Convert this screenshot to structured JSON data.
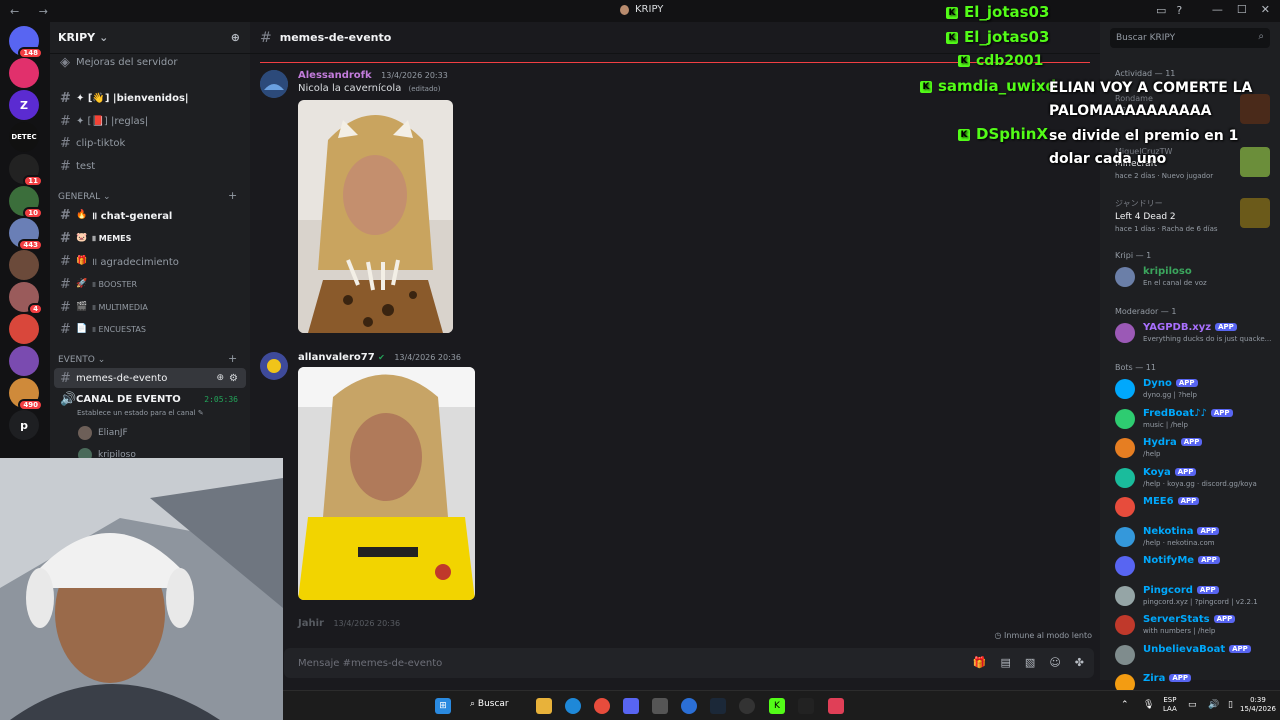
{
  "window": {
    "title": "KRIPY",
    "nav": "← →",
    "controls": [
      "—",
      "☐",
      "✕"
    ]
  },
  "server": {
    "name": "KRIPY",
    "boost_label": "Mejoras del servidor"
  },
  "rail": {
    "servers": [
      {
        "label": "",
        "color": "#5865f2",
        "badge": "148"
      },
      {
        "label": "",
        "color": "#e1306c",
        "badge": ""
      },
      {
        "label": "Z",
        "color": "#5b2bd1",
        "badge": ""
      },
      {
        "label": "DETEC",
        "color": "#111",
        "badge": ""
      },
      {
        "label": "",
        "color": "#222",
        "badge": "11"
      },
      {
        "label": "",
        "color": "#3b6e3b",
        "badge": "10"
      },
      {
        "label": "",
        "color": "#6a7fb6",
        "badge": "443"
      },
      {
        "label": "",
        "color": "#6b4a3a",
        "badge": ""
      },
      {
        "label": "",
        "color": "#9a5b5b",
        "badge": "4"
      },
      {
        "label": "",
        "color": "#d9473b",
        "badge": ""
      },
      {
        "label": "",
        "color": "#7a4bb0",
        "badge": ""
      },
      {
        "label": "",
        "color": "#cf8a3a",
        "badge": "490"
      },
      {
        "label": "p",
        "color": "#1e1f22",
        "badge": ""
      }
    ]
  },
  "channels": {
    "top": [
      {
        "name": "✦ [👋] |bienvenidos|",
        "bold": true
      },
      {
        "name": "✦ [📕] |reglas|",
        "bold": false
      },
      {
        "name": "clip-tiktok",
        "bold": false
      },
      {
        "name": "test",
        "bold": false
      }
    ],
    "general_label": "GENERAL",
    "general": [
      {
        "emoji": "🔥",
        "name": "॥ chat-general",
        "bold": true
      },
      {
        "emoji": "🐷",
        "name": "॥ MEMES",
        "bold": true
      },
      {
        "emoji": "🎁",
        "name": "॥ agradecimiento",
        "bold": false
      },
      {
        "emoji": "🚀",
        "name": "॥ BOOSTER",
        "bold": false
      },
      {
        "emoji": "🎬",
        "name": "॥ MULTIMEDIA",
        "bold": false
      },
      {
        "emoji": "📄",
        "name": "॥ ENCUESTAS",
        "bold": false
      }
    ],
    "evento_label": "EVENTO",
    "active": "memes-de-evento",
    "voice": {
      "name": "CANAL DE EVENTO",
      "timer": "2:05:36",
      "status": "Establece un estado para el canal"
    },
    "voice_users": [
      "ElianJF",
      "kripiloso"
    ]
  },
  "chat": {
    "channel": "memes-de-evento",
    "messages": [
      {
        "user": "Alessandrofk",
        "color": "#c27cdb",
        "time": "13/4/2026 20:33",
        "text": "Nicola la cavernícola",
        "edited": "(editado)"
      },
      {
        "user": "allanvalero77",
        "color": "#f2f3f5",
        "time": "13/4/2026 20:36",
        "text": "",
        "edited": ""
      },
      {
        "user": "Jahir",
        "color": "#949ba4",
        "time": "13/4/2026 20:36",
        "text": "",
        "edited": ""
      }
    ],
    "slowmode": "Inmune al modo lento",
    "placeholder": "Mensaje #memes-de-evento"
  },
  "members": {
    "search": "Buscar KRIPY",
    "activity_label": "Actividad — 11",
    "activities": [
      {
        "user": "Rondame",
        "game": "",
        "status": "2:22"
      },
      {
        "user": "MiguelCruzTW",
        "game": "Minecraft",
        "status": "hace 2 días · Nuevo jugador"
      },
      {
        "user": "ジャンドリー",
        "game": "Left 4 Dead 2",
        "status": "hace 1 días · Racha de 6 días"
      }
    ],
    "groups": [
      {
        "label": "Kripi — 1",
        "items": [
          {
            "name": "kripiloso",
            "sub": "En el canal de voz",
            "color": "#3ba55d",
            "app": false
          }
        ]
      },
      {
        "label": "Moderador — 1",
        "items": [
          {
            "name": "YAGPDB.xyz",
            "sub": "Everything ducks do is just quacke...",
            "color": "#a970ff",
            "app": true
          }
        ]
      },
      {
        "label": "Bots — 11",
        "items": [
          {
            "name": "Dyno",
            "sub": "dyno.gg | ?help",
            "color": "#00a8fc",
            "app": true
          },
          {
            "name": "FredBoat♪♪",
            "sub": "music | /help",
            "color": "#00a8fc",
            "app": true
          },
          {
            "name": "Hydra",
            "sub": "/help",
            "color": "#00a8fc",
            "app": true
          },
          {
            "name": "Koya",
            "sub": "/help · koya.gg · discord.gg/koya",
            "color": "#00a8fc",
            "app": true
          },
          {
            "name": "MEE6",
            "sub": "",
            "color": "#00a8fc",
            "app": true
          },
          {
            "name": "Nekotina",
            "sub": "/help · nekotina.com",
            "color": "#00a8fc",
            "app": true
          },
          {
            "name": "NotifyMe",
            "sub": "",
            "color": "#00a8fc",
            "app": true
          },
          {
            "name": "Pingcord",
            "sub": "pingcord.xyz | ?pingcord | v2.2.1",
            "color": "#00a8fc",
            "app": true
          },
          {
            "name": "ServerStats",
            "sub": "with numbers | /help",
            "color": "#00a8fc",
            "app": true
          },
          {
            "name": "UnbelievaBoat",
            "sub": "",
            "color": "#00a8fc",
            "app": true
          },
          {
            "name": "Zira",
            "sub": "",
            "color": "#00a8fc",
            "app": true
          }
        ]
      }
    ],
    "app_label": "APP"
  },
  "overlay": [
    {
      "user": "El_jotas03",
      "msg": ""
    },
    {
      "user": "El_jotas03",
      "msg": ""
    },
    {
      "user": "cdb2001",
      "msg": ""
    },
    {
      "user": "samdia_uwixd",
      "msg": "ELIAN VOY A COMERTE LA PALOMAAAAAAAAAA"
    },
    {
      "user": "DSphinX",
      "msg": "se divide el premio en 1 dolar cada uno"
    }
  ],
  "taskbar": {
    "search": "Buscar",
    "lang": "ESP",
    "lang2": "LAA",
    "time": "0:39",
    "date": "15/4/2026"
  }
}
